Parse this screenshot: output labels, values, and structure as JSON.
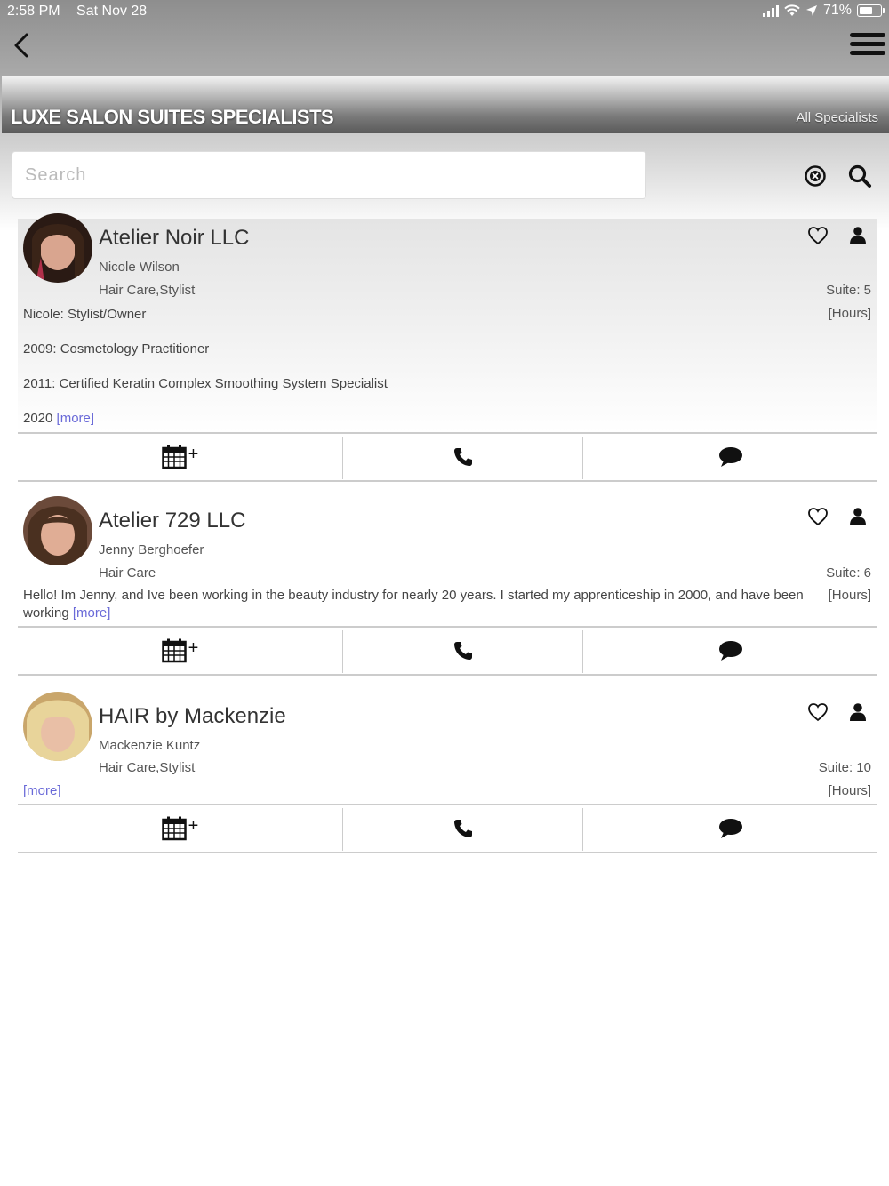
{
  "status_bar": {
    "time": "2:58 PM",
    "date": "Sat Nov 28",
    "battery": "71%",
    "battery_level": 0.71
  },
  "header": {
    "title": "LUXE SALON SUITES SPECIALISTS",
    "filter_link": "All Specialists"
  },
  "search": {
    "placeholder": "Search",
    "value": ""
  },
  "specialists": [
    {
      "business": "Atelier Noir LLC",
      "person": "Nicole Wilson",
      "category": "Hair Care,Stylist",
      "suite": "Suite: 5",
      "hours": "[Hours]",
      "description": [
        "Nicole: Stylist/Owner",
        "2009: Cosmetology Practitioner",
        "2011: Certified Keratin Complex Smoothing System Specialist",
        "2020"
      ],
      "more": "[more]",
      "avatar_colors": {
        "hair": "#3a2418",
        "skin": "#d9a58f",
        "accent": "#b0304a"
      }
    },
    {
      "business": "Atelier 729 LLC",
      "person": "Jenny Berghoefer",
      "category": "Hair Care",
      "suite": "Suite: 6",
      "hours": "[Hours]",
      "description": [
        "Hello! Im Jenny, and Ive been working in the beauty industry for nearly 20 years. I started my apprenticeship in 2000, and have been",
        "working"
      ],
      "more": "[more]",
      "avatar_colors": {
        "hair": "#4a3020",
        "skin": "#e0ad95",
        "accent": "#6b4a3a"
      }
    },
    {
      "business": "HAIR by Mackenzie",
      "person": "Mackenzie Kuntz",
      "category": "Hair Care,Stylist",
      "suite": "Suite: 10",
      "hours": "[Hours]",
      "description": [],
      "more": "[more]",
      "avatar_colors": {
        "hair": "#e8d49a",
        "skin": "#e9bfa6",
        "accent": "#c9a66b"
      }
    }
  ],
  "colors": {
    "link": "#6a6ad8",
    "divider": "#cccccc"
  }
}
